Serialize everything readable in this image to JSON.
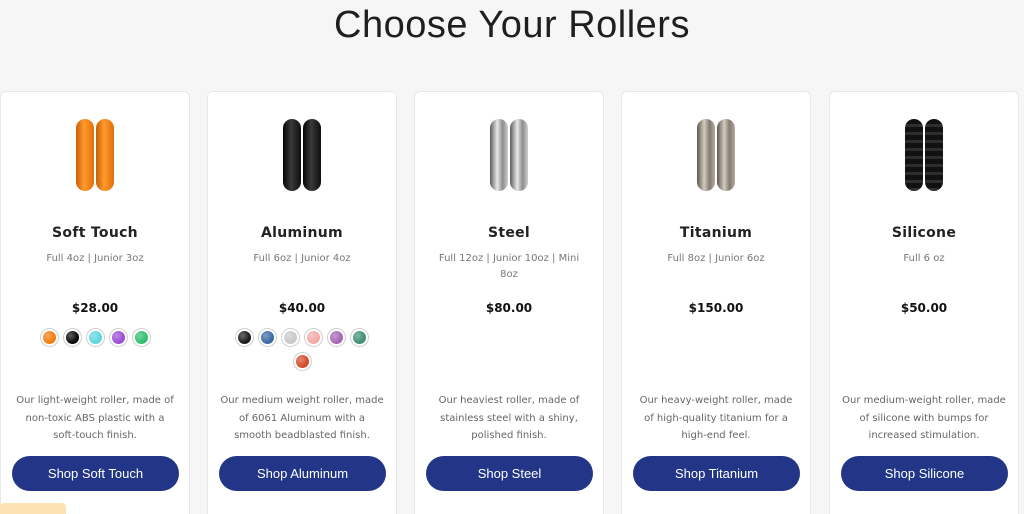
{
  "heading": "Choose Your Rollers",
  "products": [
    {
      "name": "Soft Touch",
      "sizes": "Full 4oz | Junior 3oz",
      "price": "$28.00",
      "swatches": [
        "#f07d0d",
        "#0a0a0a",
        "#5fd6df",
        "#9a4dd6",
        "#2fbf6e"
      ],
      "description": "Our light-weight roller, made of non-toxic ABS plastic with a soft-touch finish.",
      "button_label": "Shop Soft Touch",
      "roller_color": "#f5800f"
    },
    {
      "name": "Aluminum",
      "sizes": "Full 6oz | Junior 4oz",
      "price": "$40.00",
      "swatches": [
        "#1b1b1b",
        "#3c6aa5",
        "#c9c9c9",
        "#f1aaa6",
        "#a766b5",
        "#3f8f77",
        "#d44a2c"
      ],
      "description": "Our medium weight roller, made of 6061 Aluminum with a smooth beadblasted finish.",
      "button_label": "Shop Aluminum",
      "roller_color": "#121212"
    },
    {
      "name": "Steel",
      "sizes": "Full 12oz | Junior 10oz | Mini 8oz",
      "price": "$80.00",
      "swatches": [],
      "description": "Our heaviest roller, made of stainless steel with a shiny, polished finish.",
      "button_label": "Shop Steel",
      "roller_color": "#8f8f8f"
    },
    {
      "name": "Titanium",
      "sizes": "Full 8oz | Junior 6oz",
      "price": "$150.00",
      "swatches": [],
      "description": "Our heavy-weight roller, made of high-quality titanium for a high-end feel.",
      "button_label": "Shop Titanium",
      "roller_color": "#8a8378"
    },
    {
      "name": "Silicone",
      "sizes": "Full 6 oz",
      "price": "$50.00",
      "swatches": [],
      "description": "Our medium-weight roller, made of silicone with bumps for increased stimulation.",
      "button_label": "Shop Silicone",
      "roller_color": "#1e1e1e"
    }
  ],
  "colors": {
    "button_bg": "#233587",
    "page_bg": "#f6f6f6",
    "card_bg": "#ffffff"
  }
}
